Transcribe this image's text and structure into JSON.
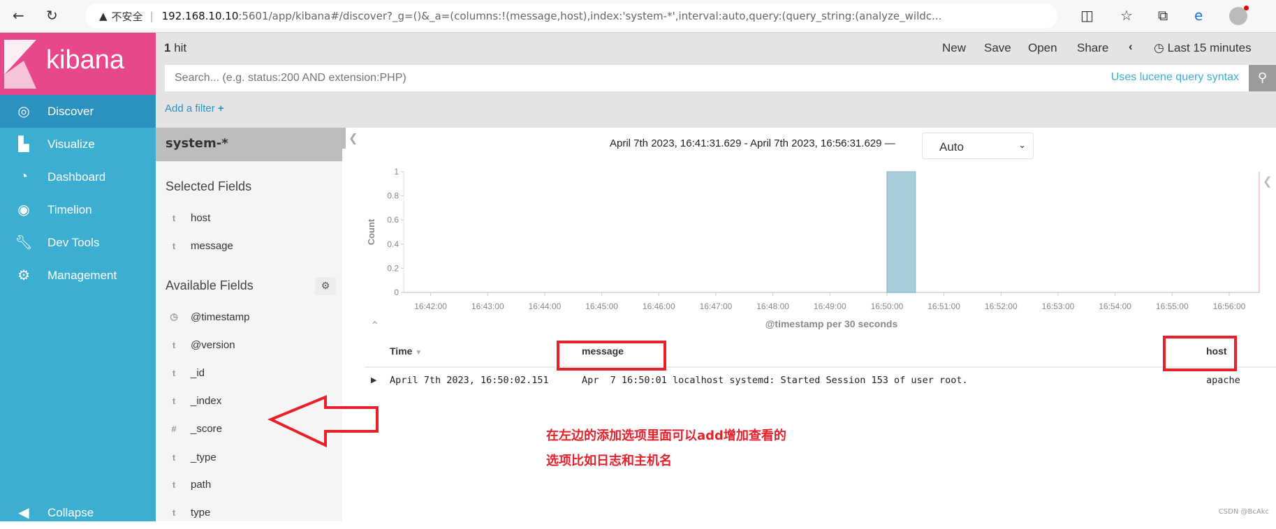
{
  "browser": {
    "url_warning": "不安全",
    "url_host": "192.168.10.10",
    "url_rest": ":5601/app/kibana#/discover?_g=()&_a=(columns:!(message,host),index:'system-*',interval:auto,query:(query_string:(analyze_wildc..."
  },
  "app": {
    "logo": "kibana"
  },
  "sidebar": {
    "items": [
      {
        "label": "Discover",
        "icon": "compass-icon"
      },
      {
        "label": "Visualize",
        "icon": "bar-chart-icon"
      },
      {
        "label": "Dashboard",
        "icon": "dashboard-icon"
      },
      {
        "label": "Timelion",
        "icon": "timelion-icon"
      },
      {
        "label": "Dev Tools",
        "icon": "wrench-icon"
      },
      {
        "label": "Management",
        "icon": "gear-icon"
      }
    ],
    "collapse": "Collapse"
  },
  "topbar": {
    "hits": "1",
    "hits_label": "hit",
    "new": "New",
    "save": "Save",
    "open": "Open",
    "share": "Share",
    "time": "Last 15 minutes"
  },
  "search": {
    "placeholder": "Search... (e.g. status:200 AND extension:PHP)",
    "syntax": "Uses lucene query syntax"
  },
  "filter": {
    "add": "Add a filter"
  },
  "fields": {
    "index": "system-*",
    "selected_title": "Selected Fields",
    "selected": [
      {
        "type": "t",
        "name": "host"
      },
      {
        "type": "t",
        "name": "message"
      }
    ],
    "available_title": "Available Fields",
    "available": [
      {
        "type": "clock",
        "name": "@timestamp"
      },
      {
        "type": "t",
        "name": "@version"
      },
      {
        "type": "t",
        "name": "_id"
      },
      {
        "type": "t",
        "name": "_index"
      },
      {
        "type": "#",
        "name": "_score"
      },
      {
        "type": "t",
        "name": "_type"
      },
      {
        "type": "t",
        "name": "path"
      },
      {
        "type": "t",
        "name": "type"
      }
    ]
  },
  "chart_header": {
    "range": "April 7th 2023, 16:41:31.629 - April 7th 2023, 16:56:31.629 —",
    "interval": "Auto"
  },
  "chart_data": {
    "type": "bar",
    "xlabel": "@timestamp per 30 seconds",
    "ylabel": "Count",
    "xlim": [
      "16:41:31.629",
      "16:56:31.629"
    ],
    "ylim": [
      0,
      1
    ],
    "yticks": [
      "0",
      "0.2",
      "0.4",
      "0.6",
      "0.8",
      "1"
    ],
    "xticks": [
      "16:42:00",
      "16:43:00",
      "16:44:00",
      "16:45:00",
      "16:46:00",
      "16:47:00",
      "16:48:00",
      "16:49:00",
      "16:50:00",
      "16:51:00",
      "16:52:00",
      "16:53:00",
      "16:54:00",
      "16:55:00",
      "16:56:00"
    ],
    "bars": [
      {
        "x": "16:50:00",
        "value": 1
      }
    ],
    "bar_color": "#a8cfd9"
  },
  "table": {
    "headers": {
      "time": "Time",
      "message": "message",
      "host": "host"
    },
    "rows": [
      {
        "time": "April 7th 2023, 16:50:02.151",
        "message": "Apr  7 16:50:01 localhost systemd: Started Session 153 of user root.",
        "host": "apache"
      }
    ]
  },
  "annotation": {
    "line1": "在左边的添加选项里面可以add增加查看的",
    "line2": "选项比如日志和主机名",
    "watermark": "CSDN @BcAkc"
  }
}
